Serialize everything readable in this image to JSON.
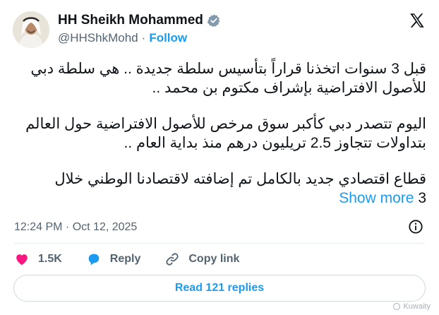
{
  "header": {
    "display_name": "HH Sheikh Mohammed",
    "handle": "@HHShkMohd",
    "separator": "·",
    "follow_label": "Follow"
  },
  "tweet": {
    "p1_line1": "قبل 3 سنوات اتخذنا قراراً بتأسيس سلطة جديدة .. هي سلطة دبي",
    "p1_line2": "للأصول الافتراضية بإشراف مكتوم بن محمد ..",
    "p2_line1": "اليوم تتصدر دبي كأكبر سوق مرخص للأصول الافتراضية حول العالم",
    "p2_line2": "بتداولات تتجاوز 2.5 تريليون درهم منذ بداية العام ..",
    "p3_line1": "قطاع اقتصادي جديد بالكامل تم إضافته لاقتصادنا الوطني خلال",
    "p3_line2_text": "3",
    "show_more_label": "Show more"
  },
  "meta": {
    "timestamp": "12:24 PM · Oct 12, 2025"
  },
  "actions": {
    "likes_count": "1.5K",
    "reply_label": "Reply",
    "copy_link_label": "Copy link"
  },
  "read_replies_label": "Read 121 replies",
  "watermark_text": "Kuwaity",
  "colors": {
    "accent": "#1d9bf0",
    "like": "#f91880",
    "reply": "#1d9bf0",
    "verified": "#829aab"
  }
}
